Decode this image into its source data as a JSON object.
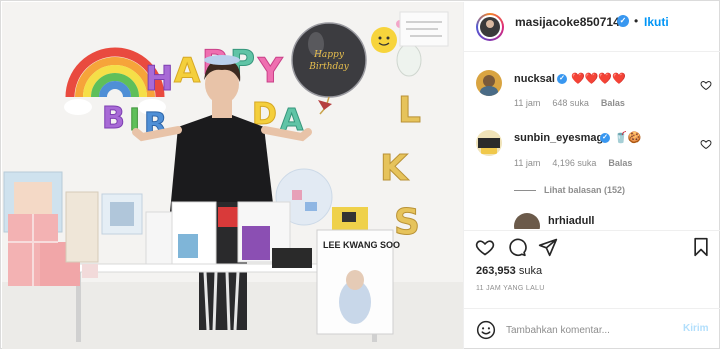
{
  "post": {
    "author": {
      "username": "masijacoke850714",
      "verified_glyph": "✓",
      "separator": "•",
      "follow_label": "Ikuti"
    },
    "photo": {
      "balloon_banner": "HAPPY BIRTHDAY",
      "balloon_side_letters": "LKS",
      "sign_text": "LEE KWANG SOO",
      "clear_balloon_text": "Happy Birthday"
    },
    "comments": [
      {
        "username": "nucksal",
        "verified": true,
        "verified_glyph": "✓",
        "text": "❤️❤️❤️❤️",
        "time": "11 jam",
        "likes": "648 suka",
        "reply_label": "Balas"
      },
      {
        "username": "sunbin_eyesmag",
        "verified": true,
        "verified_glyph": "✓",
        "text": "🥤🍪",
        "time": "11 jam",
        "likes": "4,196 suka",
        "reply_label": "Balas"
      }
    ],
    "view_replies_label": "Lihat balasan (152)",
    "partial_comment_user": "hrhiadull",
    "likes_count": "263,953",
    "likes_suffix": "suka",
    "timestamp": "11 JAM YANG LALU",
    "add_comment": {
      "placeholder": "Tambahkan komentar...",
      "post_label": "Kirim"
    }
  },
  "colors": {
    "accent_blue": "#0095f6",
    "muted_post": "#b2dffc",
    "heart_red": "#ed4956",
    "text_dark": "#262626",
    "text_muted": "#8e8e8e"
  },
  "icons": {
    "like": "heart-icon",
    "comment": "comment-icon",
    "share": "paper-plane-icon",
    "save": "bookmark-icon",
    "emoji": "smiley-icon",
    "comment_like": "small-heart-icon"
  }
}
